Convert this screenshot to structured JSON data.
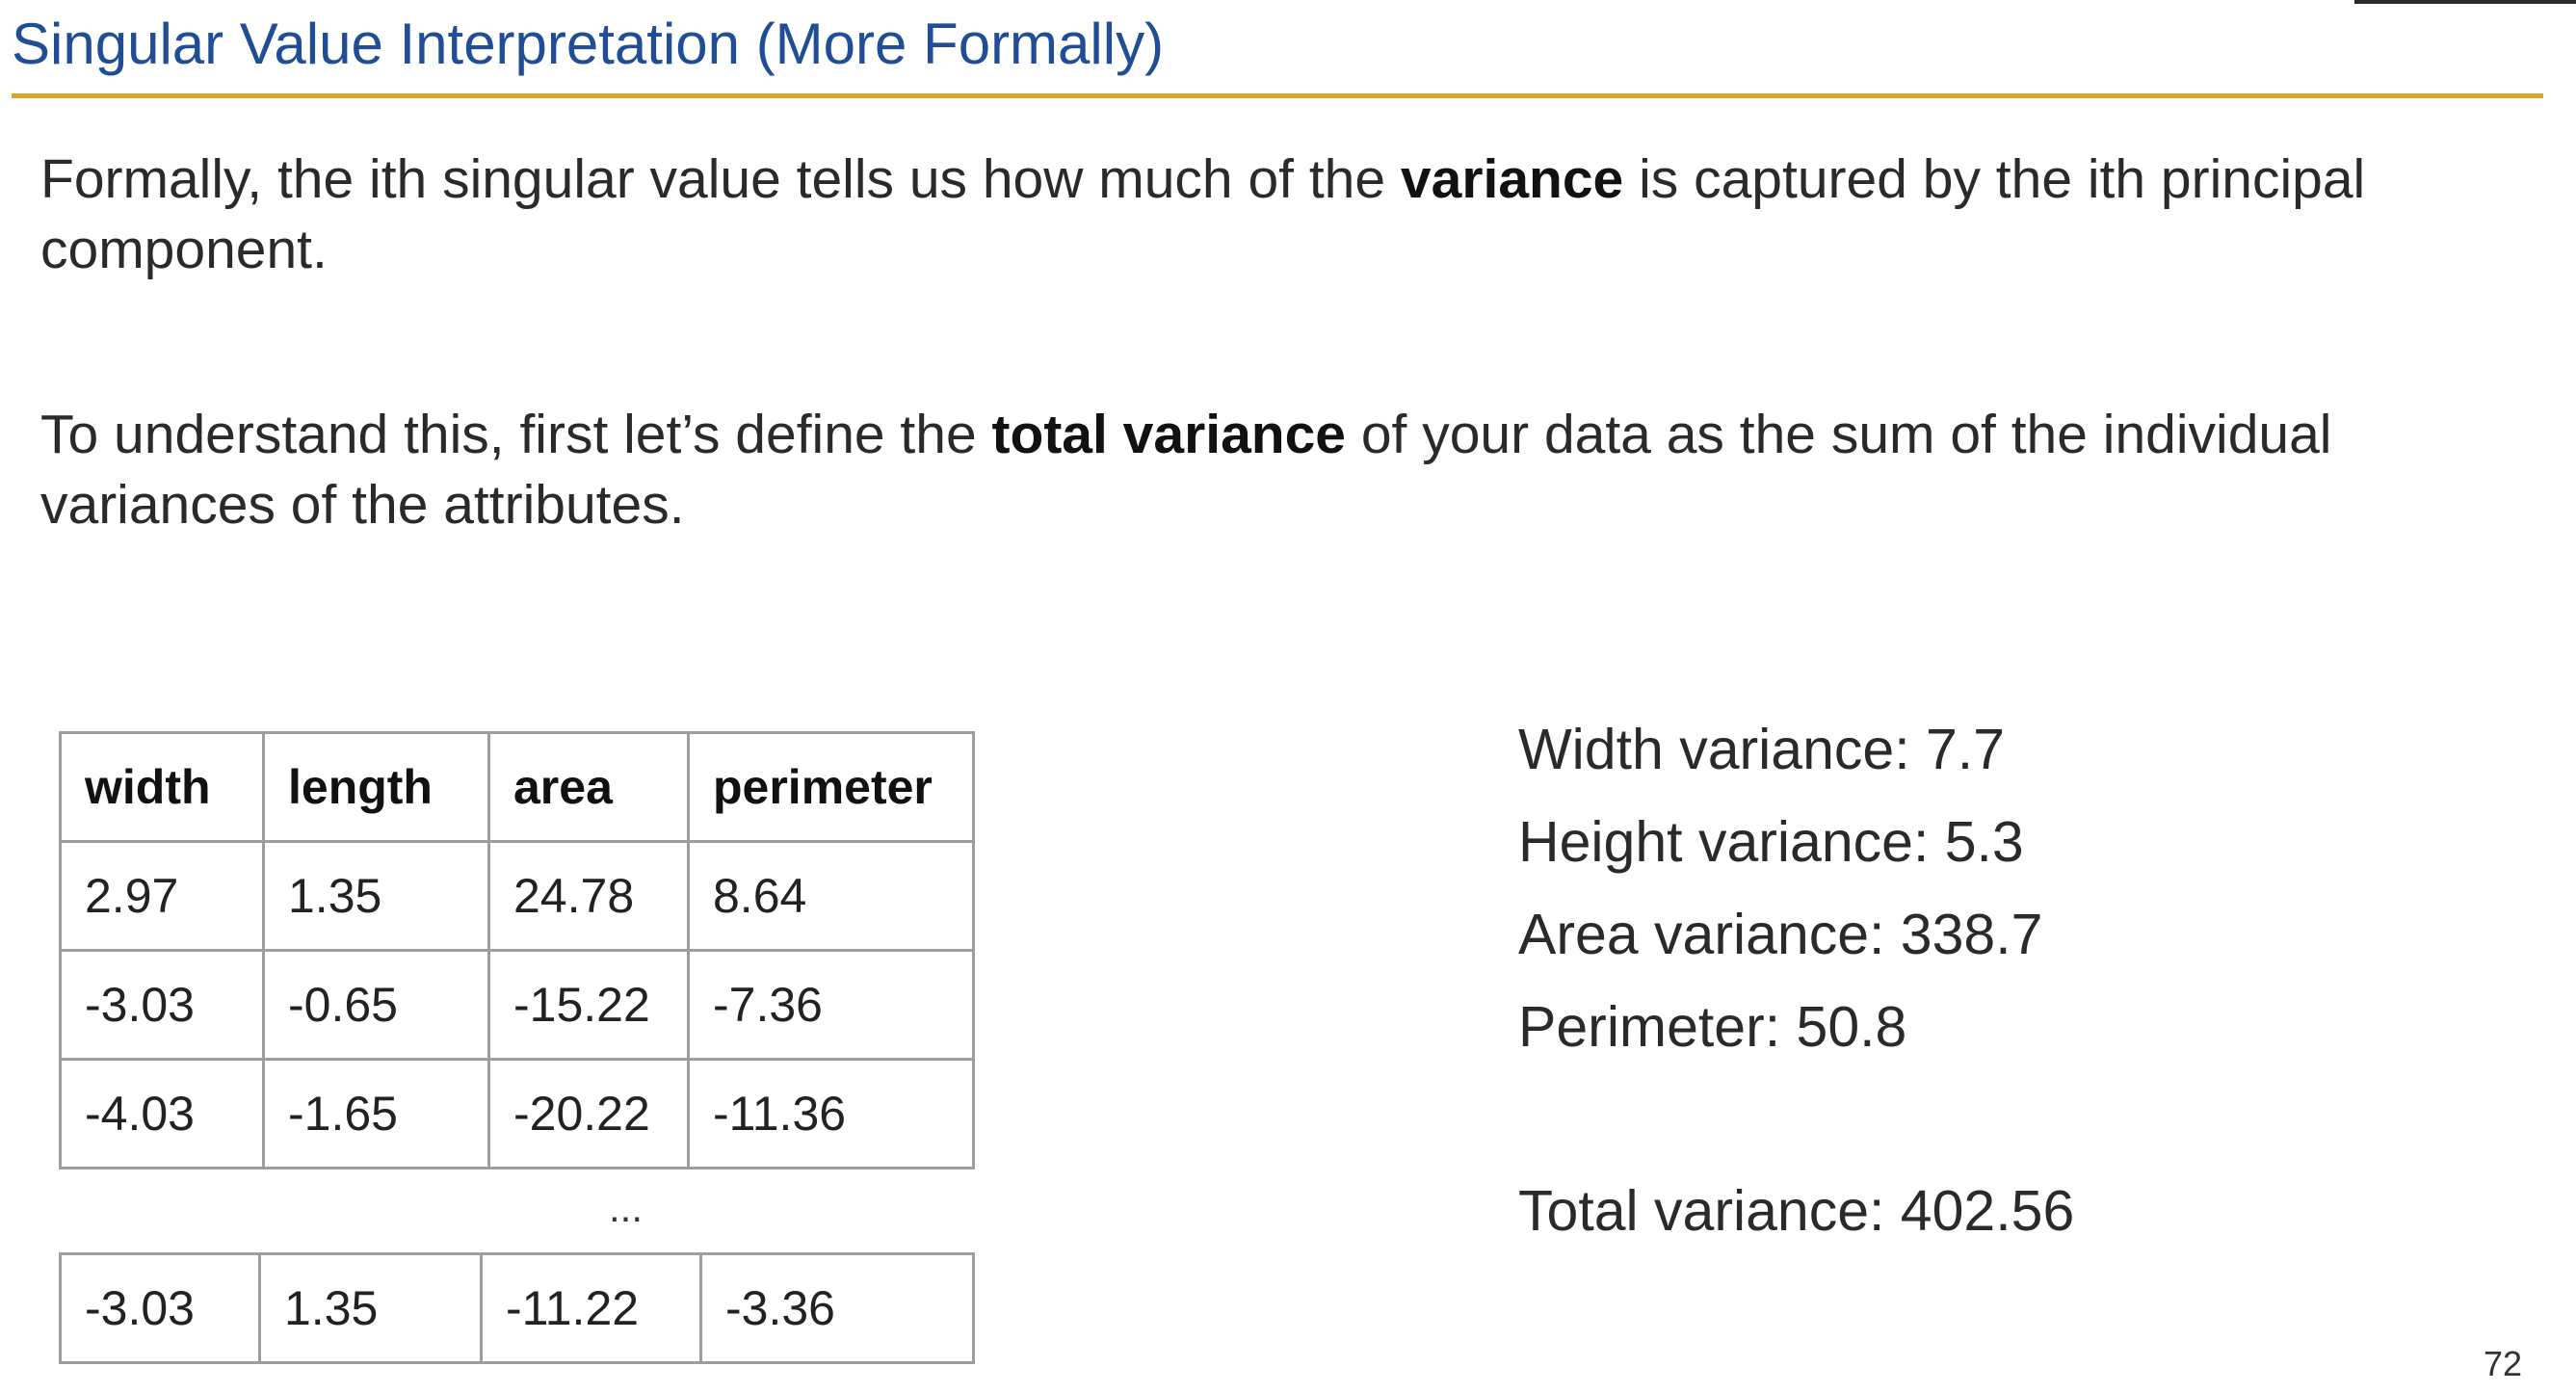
{
  "slide": {
    "title": "Singular Value Interpretation (More Formally)",
    "para1": {
      "pre": "Formally, the ith singular value tells us how much of the ",
      "bold": "variance",
      "post": " is captured by the ith principal component."
    },
    "para2": {
      "pre": "To understand this, first let’s define the ",
      "bold": "total variance",
      "post": " of your data as the sum of the individual variances of the attributes."
    },
    "table": {
      "headers": [
        "width",
        "length",
        "area",
        "perimeter"
      ],
      "rows": [
        [
          "2.97",
          "1.35",
          "24.78",
          "8.64"
        ],
        [
          "-3.03",
          "-0.65",
          "-15.22",
          "-7.36"
        ],
        [
          "-4.03",
          "-1.65",
          "-20.22",
          "-11.36"
        ]
      ],
      "ellipsis": "...",
      "last_row": [
        "-3.03",
        "1.35",
        "-11.22",
        "-3.36"
      ]
    },
    "variances": [
      "Width variance: 7.7",
      "Height variance: 5.3",
      "Area variance: 338.7",
      "Perimeter: 50.8"
    ],
    "total": "Total variance: 402.56",
    "page_number": "72",
    "colors": {
      "title": "#1f4e96",
      "rule": "#d4a82a"
    }
  }
}
